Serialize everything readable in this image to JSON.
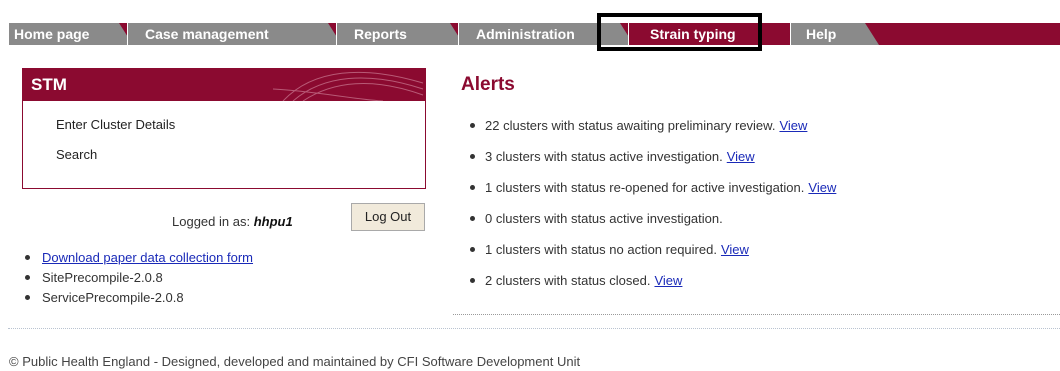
{
  "nav": {
    "tabs": [
      {
        "label": "Home page"
      },
      {
        "label": "Case management"
      },
      {
        "label": "Reports"
      },
      {
        "label": "Administration"
      },
      {
        "label": "Strain typing"
      },
      {
        "label": "Help"
      }
    ],
    "active_tab": "Strain typing"
  },
  "stm": {
    "title": "STM",
    "links": [
      "Enter Cluster Details",
      "Search"
    ]
  },
  "session": {
    "logged_in_prefix": "Logged in as:",
    "username": "hhpu1",
    "logout_label": "Log Out"
  },
  "left_links": {
    "download_form": "Download paper data collection form",
    "site_version": "SitePrecompile-2.0.8",
    "service_version": "ServicePrecompile-2.0.8"
  },
  "alerts": {
    "title": "Alerts",
    "items": [
      {
        "text": "22 clusters with status awaiting preliminary review.",
        "link": "View"
      },
      {
        "text": "3 clusters with status active investigation.",
        "link": "View"
      },
      {
        "text": "1 clusters with status re-opened for active investigation.",
        "link": "View"
      },
      {
        "text": "0 clusters with status active investigation.",
        "link": ""
      },
      {
        "text": "1 clusters with status no action required.",
        "link": "View"
      },
      {
        "text": "2 clusters with status closed.",
        "link": "View"
      }
    ]
  },
  "footer": {
    "text": "© Public Health England - Designed, developed and maintained by CFI Software Development Unit"
  },
  "colors": {
    "brand": "#8b0a30",
    "tab_inactive": "#8a8a8a",
    "link": "#1a2ab8"
  }
}
